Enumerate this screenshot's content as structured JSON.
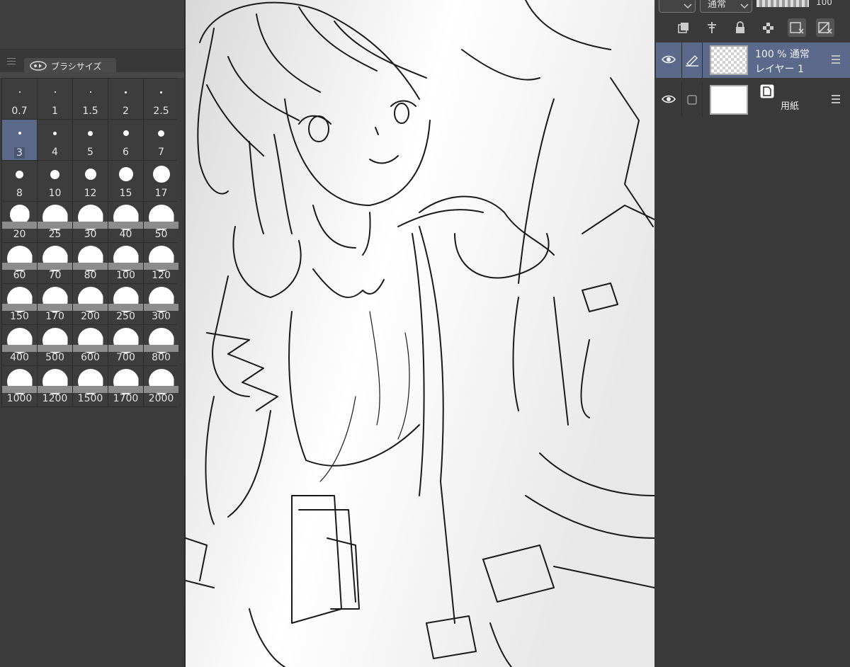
{
  "brush_panel": {
    "tab_label": "ブラシサイズ",
    "tab_icon": "brush-size-icon",
    "selected_size": "3",
    "sizes": [
      {
        "label": "0.7",
        "dot": 2
      },
      {
        "label": "1",
        "dot": 2
      },
      {
        "label": "1.5",
        "dot": 2
      },
      {
        "label": "2",
        "dot": 3
      },
      {
        "label": "2.5",
        "dot": 3
      },
      {
        "label": "3",
        "dot": 4
      },
      {
        "label": "4",
        "dot": 5
      },
      {
        "label": "5",
        "dot": 7
      },
      {
        "label": "6",
        "dot": 8
      },
      {
        "label": "7",
        "dot": 9
      },
      {
        "label": "8",
        "dot": 11
      },
      {
        "label": "10",
        "dot": 13
      },
      {
        "label": "12",
        "dot": 16
      },
      {
        "label": "15",
        "dot": 20
      },
      {
        "label": "17",
        "dot": 24
      },
      {
        "label": "20",
        "dot": 28
      },
      {
        "label": "25",
        "dot": 36
      },
      {
        "label": "30",
        "dot": 36
      },
      {
        "label": "40",
        "dot": 36
      },
      {
        "label": "50",
        "dot": 36
      },
      {
        "label": "60",
        "dot": 36
      },
      {
        "label": "70",
        "dot": 36
      },
      {
        "label": "80",
        "dot": 36
      },
      {
        "label": "100",
        "dot": 36
      },
      {
        "label": "120",
        "dot": 36
      },
      {
        "label": "150",
        "dot": 36
      },
      {
        "label": "170",
        "dot": 36
      },
      {
        "label": "200",
        "dot": 36
      },
      {
        "label": "250",
        "dot": 36
      },
      {
        "label": "300",
        "dot": 36
      },
      {
        "label": "400",
        "dot": 36
      },
      {
        "label": "500",
        "dot": 36
      },
      {
        "label": "600",
        "dot": 36
      },
      {
        "label": "700",
        "dot": 36
      },
      {
        "label": "800",
        "dot": 36
      },
      {
        "label": "1000",
        "dot": 36
      },
      {
        "label": "1200",
        "dot": 36
      },
      {
        "label": "1500",
        "dot": 36
      },
      {
        "label": "1700",
        "dot": 36
      },
      {
        "label": "2000",
        "dot": 36
      }
    ]
  },
  "layer_panel": {
    "blend_mode_top": "通常",
    "opacity_top": "100",
    "layers": [
      {
        "opacity_blend": "100 % 通常",
        "name": "レイヤー 1",
        "selected": true,
        "thumbnail": "transparent"
      },
      {
        "name": "用紙",
        "selected": false,
        "thumbnail": "white"
      }
    ],
    "toolbar_icons": [
      "layer-copy-icon",
      "clip-pin-icon",
      "lock-icon",
      "transparency-lock-icon",
      "reference-layer-icon",
      "mask-icon"
    ]
  },
  "canvas": {
    "content": "line-art-sketch"
  }
}
